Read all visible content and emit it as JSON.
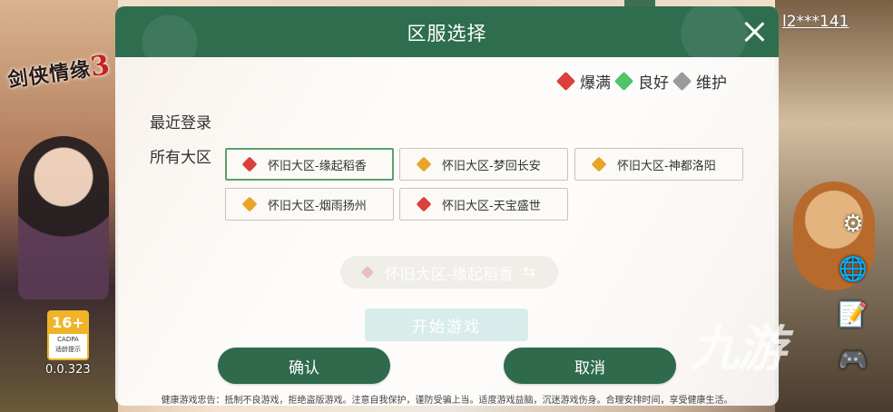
{
  "user_id": "l2***141",
  "version": "0.0.323",
  "age_badge": {
    "age": "16+",
    "org": "CADPA",
    "tip": "适龄提示"
  },
  "logo": {
    "text": "剑侠情缘",
    "num": "3"
  },
  "watermark": "九游",
  "modal": {
    "title": "区服选择",
    "legend": [
      {
        "label": "爆满",
        "color": "#d9413a"
      },
      {
        "label": "良好",
        "color": "#4fc46a"
      },
      {
        "label": "维护",
        "color": "#9a9a9a"
      }
    ],
    "recent_label": "最近登录",
    "all_label": "所有大区",
    "servers": [
      {
        "name": "怀旧大区-缘起稻香",
        "status_color": "#d9413a",
        "selected": true
      },
      {
        "name": "怀旧大区-梦回长安",
        "status_color": "#e8a52a",
        "selected": false
      },
      {
        "name": "怀旧大区-神都洛阳",
        "status_color": "#e8a52a",
        "selected": false
      },
      {
        "name": "怀旧大区-烟雨扬州",
        "status_color": "#e8a52a",
        "selected": false
      },
      {
        "name": "怀旧大区-天宝盛世",
        "status_color": "#d9413a",
        "selected": false
      }
    ],
    "background_server": "怀旧大区-缘起稻香",
    "background_start": "开始游戏",
    "confirm_label": "确认",
    "cancel_label": "取消"
  },
  "health_notice": "健康游戏忠告：抵制不良游戏，拒绝盗版游戏。注意自我保护，谨防受骗上当。适度游戏益脑，沉迷游戏伤身。合理安排时间，享受健康生活。",
  "side_icons": [
    "settings-icon",
    "globe-icon",
    "notepad-icon",
    "gamepad-icon"
  ]
}
